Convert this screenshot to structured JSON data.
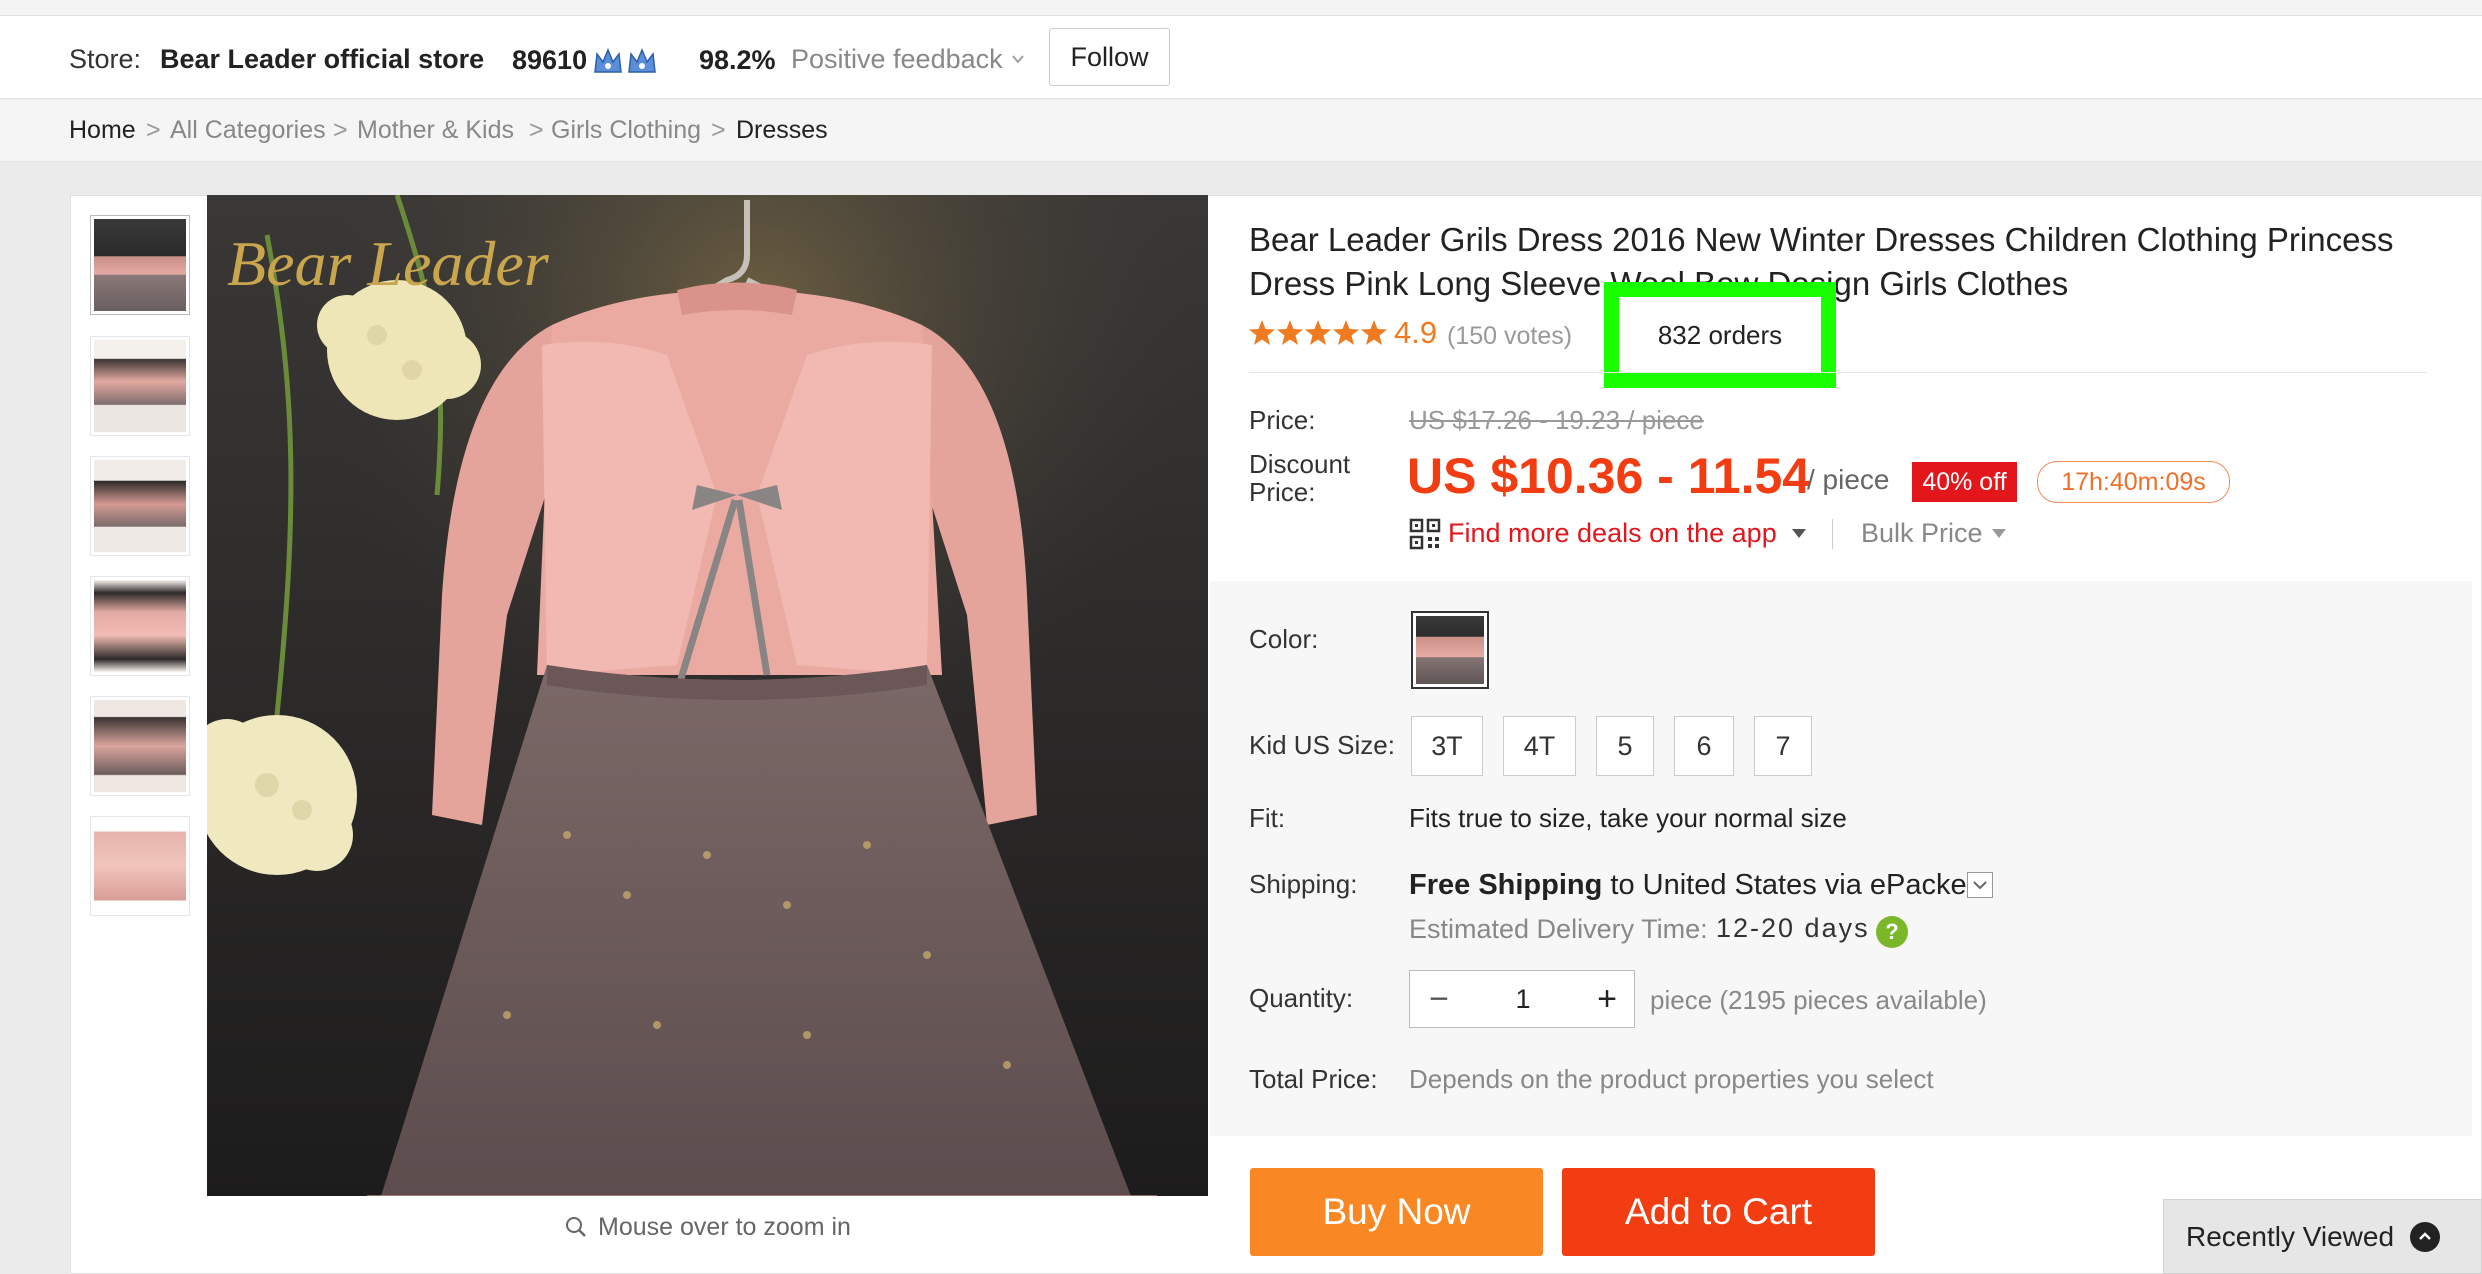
{
  "store": {
    "label": "Store:",
    "name": "Bear Leader official store",
    "score": "89610",
    "feedback_pct": "98.2%",
    "feedback_label": "Positive feedback",
    "follow_label": "Follow"
  },
  "breadcrumb": [
    "Home",
    "All Categories",
    "Mother & Kids",
    "Girls Clothing",
    "Dresses"
  ],
  "breadcrumb_sep": ">",
  "gallery": {
    "watermark": "Bear Leader",
    "zoom_hint": "Mouse over to zoom in",
    "thumbnail_count": 6
  },
  "product": {
    "title": "Bear Leader Grils Dress 2016 New Winter Dresses Children Clothing Princess Dress Pink Long Sleeve Wool Bow Design Girls Clothes",
    "rating": "4.9",
    "votes": "(150 votes)",
    "orders": "832 orders",
    "price_label": "Price:",
    "original_price": "US $17.26 - 19.23 / piece",
    "discount_label_1": "Discount",
    "discount_label_2": "Price:",
    "discount_price": "US $10.36 - 11.54",
    "per_piece": "/ piece",
    "off_badge": "40% off",
    "countdown": "17h:40m:09s",
    "app_deals": "Find more deals on the app",
    "bulk_price": "Bulk Price"
  },
  "options": {
    "color_label": "Color:",
    "size_label": "Kid US Size:",
    "sizes": [
      "3T",
      "4T",
      "5",
      "6",
      "7"
    ],
    "fit_label": "Fit:",
    "fit_value": "Fits true to size, take your normal size",
    "shipping_label": "Shipping:",
    "shipping_free": "Free Shipping",
    "shipping_rest": " to United States via ePacket",
    "eta_label": "Estimated Delivery Time:",
    "eta_value": "12-20 days",
    "quantity_label": "Quantity:",
    "quantity_value": "1",
    "available": "piece (2195 pieces available)",
    "total_label": "Total Price:",
    "total_value": "Depends on the product properties you select"
  },
  "actions": {
    "buy_now": "Buy Now",
    "add_to_cart": "Add to Cart",
    "recently_viewed": "Recently Viewed"
  },
  "colors": {
    "price_red": "#f23d12",
    "buy_orange": "#f98723",
    "highlight_green": "#1aff00",
    "rating_orange": "#f07a1f"
  }
}
